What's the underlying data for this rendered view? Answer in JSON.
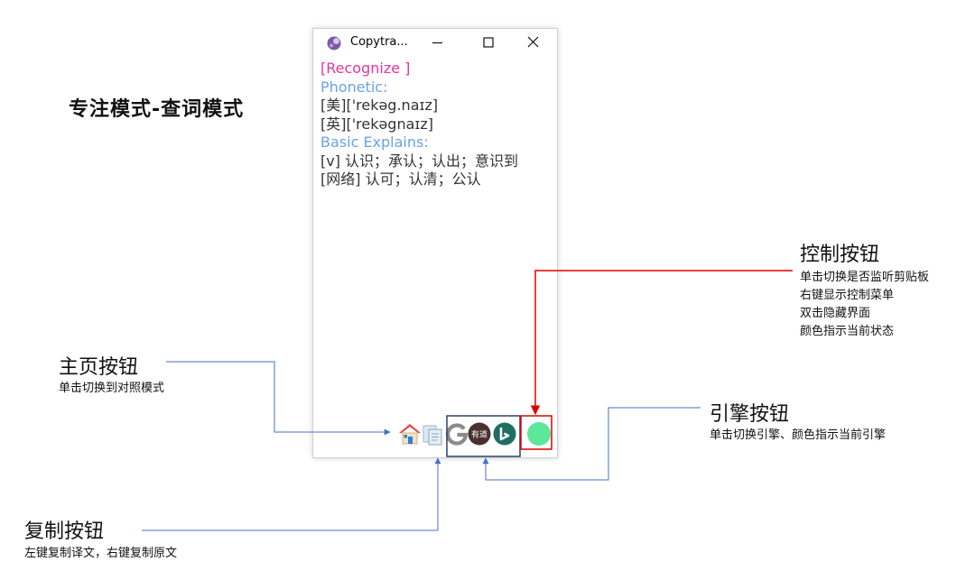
{
  "heading": "专注模式-查词模式",
  "window": {
    "title": "Copytra...",
    "content": {
      "word": "[Recognize ]",
      "phonetic_heading": "Phonetic:",
      "phonetic_us": "[美]['rekəg.naɪz]",
      "phonetic_uk": "[英]['rekəgnaɪz]",
      "explains_heading": "Basic Explains:",
      "explain_1": "[v] 认识；承认；认出；意识到",
      "explain_2": "[网络] 认可；认清；公认"
    },
    "toolbar": {
      "youdao_label": "有道",
      "engine_colors": {
        "google": "#4285f4",
        "youdao": "#4a2f2f",
        "bing": "#1f6e62"
      },
      "control_color": "#5be89a"
    }
  },
  "annotations": {
    "control": {
      "title": "控制按钮",
      "lines": [
        "单击切换是否监听剪贴板",
        "右键显示控制菜单",
        "双击隐藏界面",
        "颜色指示当前状态"
      ]
    },
    "home": {
      "title": "主页按钮",
      "lines": [
        "单击切换到对照模式"
      ]
    },
    "engine": {
      "title": "引擎按钮",
      "lines": [
        "单击切换引擎、颜色指示当前引擎"
      ]
    },
    "copy": {
      "title": "复制按钮",
      "lines": [
        "左键复制译文，右键复制原文"
      ]
    }
  },
  "colors": {
    "word": "#e8349a",
    "section": "#6aa2e6",
    "arrow_blue": "#4472c4",
    "arrow_red": "#e00000",
    "highlight_engine": "#2f3e6b"
  }
}
